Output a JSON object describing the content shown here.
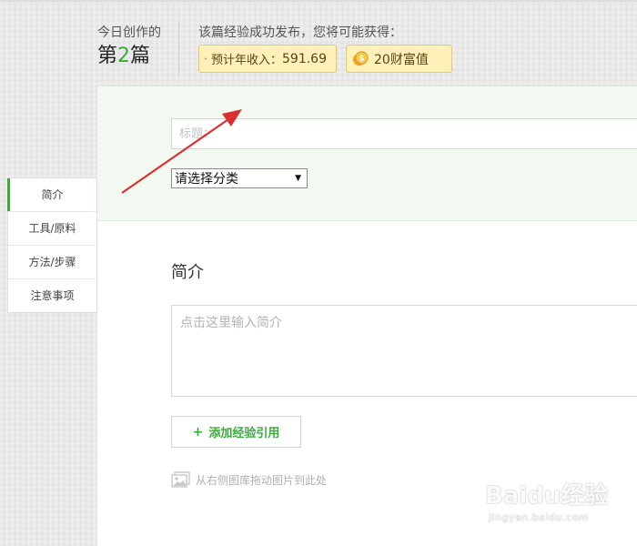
{
  "header": {
    "today_label": "今日创作的",
    "count_prefix": "第",
    "count_number": "2",
    "count_suffix": "篇",
    "publish_note": "该篇经验成功发布，您将可能获得：",
    "income": {
      "icon": "red-envelope-icon",
      "label": "预计年收入：",
      "value": "591.69"
    },
    "wealth": {
      "icon": "gold-coin-icon",
      "value": "20财富值"
    }
  },
  "sidebar": {
    "items": [
      {
        "label": "简介",
        "active": true
      },
      {
        "label": "工具/原料",
        "active": false
      },
      {
        "label": "方法/步骤",
        "active": false
      },
      {
        "label": "注意事项",
        "active": false
      }
    ]
  },
  "editor": {
    "title_placeholder": "标题：",
    "title_value": "",
    "category_selected": "请选择分类",
    "intro_heading": "简介",
    "intro_placeholder": "点击这里输入简介",
    "add_reference": {
      "plus": "+",
      "label": "添加经验引用"
    },
    "drag_hint": "从右侧图库拖动图片到此处"
  },
  "watermark": {
    "main": "Baidu经验",
    "sub": "jingyan.baidu.com"
  },
  "colors": {
    "accent_green": "#3aab3a",
    "annotation_red": "#d9302e",
    "badge_bg": "#fdf0b9",
    "editor_top_bg": "#f1f9f1"
  }
}
